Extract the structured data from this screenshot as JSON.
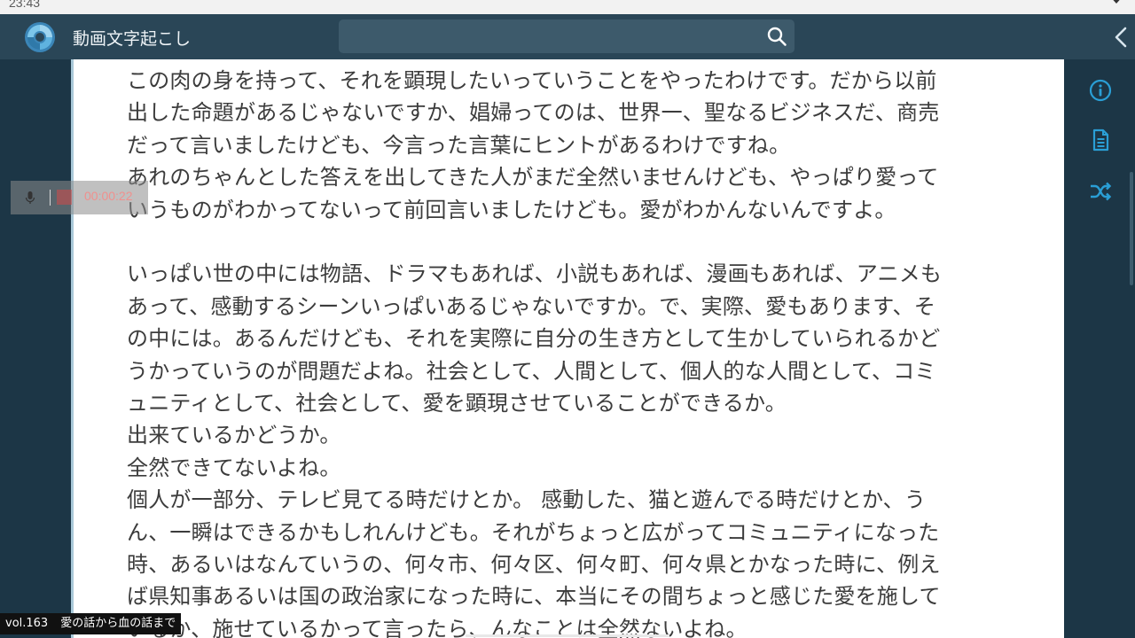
{
  "status_bar": {
    "time": "23:43"
  },
  "app_bar": {
    "title": "動画文字起こし",
    "search_placeholder": ""
  },
  "recorder": {
    "elapsed": "00:00:22"
  },
  "transcript": {
    "lines_1": [
      "この肉の身を持って、それを顕現したいっていうことをやったわけです。だから以前",
      "出した命題があるじゃないですか、娼婦ってのは、世界一、聖なるビジネスだ、商売",
      "だって言いましたけども、今言った言葉にヒントがあるわけですね。",
      "あれのちゃんとした答えを出してきた人がまだ全然いませんけども、やっぱり愛って",
      "いうものがわかってないって前回言いましたけども。愛がわかんないんですよ。"
    ],
    "lines_2": [
      "いっぱい世の中には物語、ドラマもあれば、小説もあれば、漫画もあれば、アニメも",
      "あって、感動するシーンいっぱいあるじゃないですか。で、実際、愛もあります、そ",
      "の中には。あるんだけども、それを実際に自分の生き方として生かしていられるかど",
      "うかっていうのが問題だよね。社会として、人間として、個人的な人間として、コミ",
      "ュニティとして、社会として、愛を顕現させていることができるか。",
      "出来ているかどうか。",
      "全然できてないよね。",
      "個人が一部分、テレビ見てる時だけとか。 感動した、猫と遊んでる時だけとか、う",
      "ん、一瞬はできるかもしれんけども。それがちょっと広がってコミュニティになった",
      "時、あるいはなんていうの、何々市、何々区、何々町、何々県とかなった時に、例え",
      "ば県知事あるいは国の政治家になった時に、本当にその間ちょっと感じた愛を施して",
      "いるか、施せているかって言ったら、んなことは全然ないよね。"
    ]
  },
  "caption": {
    "volume": "vol.163",
    "title": "愛の話から血の話まで"
  },
  "icons": {
    "logo": "app-logo-icon",
    "search": "search-icon",
    "back": "chevron-left-icon",
    "info": "info-icon",
    "document": "document-icon",
    "shuffle": "shuffle-icon",
    "mic": "mic-icon",
    "stop": "stop-icon"
  },
  "colors": {
    "accent": "#2a9fd6",
    "app_bar": "#2a4657",
    "background": "#1c3646",
    "recording": "#d24a4a"
  }
}
